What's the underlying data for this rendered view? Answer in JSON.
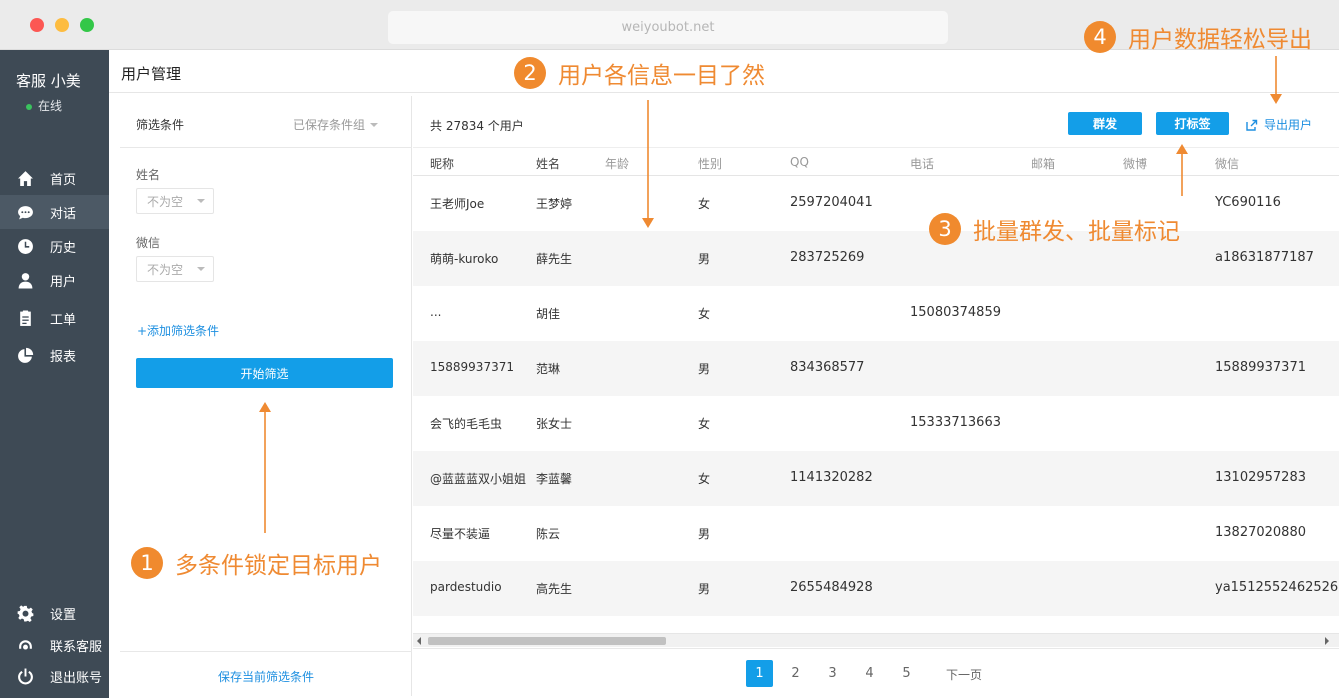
{
  "browser": {
    "url": "weiyoubot.net"
  },
  "sidebar": {
    "agent_name": "客服 小美",
    "agent_status": "在线",
    "items": [
      {
        "label": "首页",
        "icon": "home-icon"
      },
      {
        "label": "对话",
        "icon": "chat-icon"
      },
      {
        "label": "历史",
        "icon": "history-icon"
      },
      {
        "label": "用户",
        "icon": "user-icon"
      },
      {
        "label": "工单",
        "icon": "ticket-icon"
      },
      {
        "label": "报表",
        "icon": "report-icon"
      }
    ],
    "bottom_items": [
      {
        "label": "设置",
        "icon": "gear-icon"
      },
      {
        "label": "联系客服",
        "icon": "support-icon"
      },
      {
        "label": "退出账号",
        "icon": "power-icon"
      }
    ],
    "active_item": "对话"
  },
  "header": {
    "title": "用户管理"
  },
  "filter": {
    "heading": "筛选条件",
    "saved_groups": "已保存条件组",
    "fields": [
      {
        "label": "姓名",
        "value": "不为空"
      },
      {
        "label": "微信",
        "value": "不为空"
      }
    ],
    "add_condition": "+添加筛选条件",
    "start_button": "开始筛选",
    "save_current": "保存当前筛选条件"
  },
  "table": {
    "total": "共 27834 个用户",
    "mass_send": "群发",
    "tag": "打标签",
    "export": "导出用户",
    "columns": [
      "昵称",
      "姓名",
      "年龄",
      "性别",
      "QQ",
      "电话",
      "邮箱",
      "微博",
      "微信"
    ],
    "rows": [
      [
        "王老师Joe",
        "王梦婷",
        "",
        "女",
        "2597204041",
        "",
        "",
        "",
        "YC690116"
      ],
      [
        "萌萌-kuroko",
        "薛先生",
        "",
        "男",
        "283725269",
        "",
        "",
        "",
        "a18631877187"
      ],
      [
        "...",
        "胡佳",
        "",
        "女",
        "",
        "15080374859",
        "",
        "",
        ""
      ],
      [
        "15889937371",
        "范琳",
        "",
        "男",
        "834368577",
        "",
        "",
        "",
        "15889937371"
      ],
      [
        "会飞的毛毛虫",
        "张女士",
        "",
        "女",
        "",
        "15333713663",
        "",
        "",
        ""
      ],
      [
        "@蓝蓝蓝双小姐姐",
        "李蓝馨",
        "",
        "女",
        "1141320282",
        "",
        "",
        "",
        "13102957283"
      ],
      [
        "尽量不装逼",
        "陈云",
        "",
        "男",
        "",
        "",
        "",
        "",
        "13827020880"
      ],
      [
        "pardestudio",
        "高先生",
        "",
        "男",
        "2655484928",
        "",
        "",
        "",
        "ya1512552462526"
      ]
    ]
  },
  "pagination": {
    "pages": [
      "1",
      "2",
      "3",
      "4",
      "5"
    ],
    "current": "1",
    "next": "下一页"
  },
  "annotations": [
    {
      "number": "1",
      "text": "多条件锁定目标用户"
    },
    {
      "number": "2",
      "text": "用户各信息一目了然"
    },
    {
      "number": "3",
      "text": "批量群发、批量标记"
    },
    {
      "number": "4",
      "text": "用户数据轻松导出"
    }
  ],
  "colors": {
    "accent": "#139ee8",
    "link": "#1d8fe0",
    "sidebar": "#3e4a55",
    "annotation": "#f08a2e",
    "online": "#3ac35e"
  }
}
